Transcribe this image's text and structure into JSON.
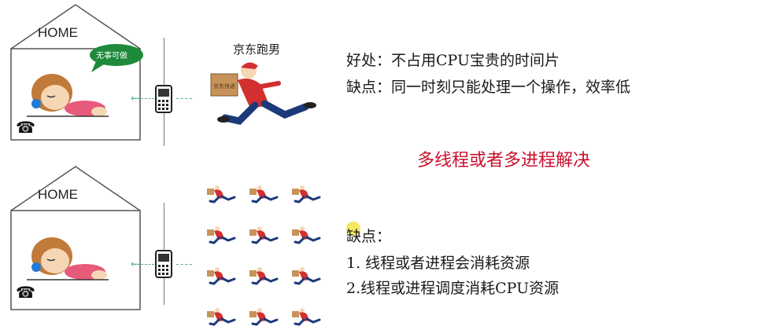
{
  "scene_top": {
    "home_label": "HOME",
    "bubble_text": "无事可做",
    "courier_title": "京东跑男",
    "box_label": "京东快递"
  },
  "scene_bottom": {
    "home_label": "HOME"
  },
  "notes_top": {
    "advantage": "好处：不占用CPU宝贵的时间片",
    "disadvantage": "缺点：同一时刻只能处理一个操作，效率低"
  },
  "solution": "多线程或者多进程解决",
  "notes_bottom": {
    "heading": "缺点：",
    "item1": "1. 线程或者进程会消耗资源",
    "item2": "2.线程或进程调度消耗CPU资源"
  },
  "colors": {
    "solution_red": "#c8102e",
    "bubble_green": "#1e8a3a",
    "courier_red": "#d32f2f"
  }
}
